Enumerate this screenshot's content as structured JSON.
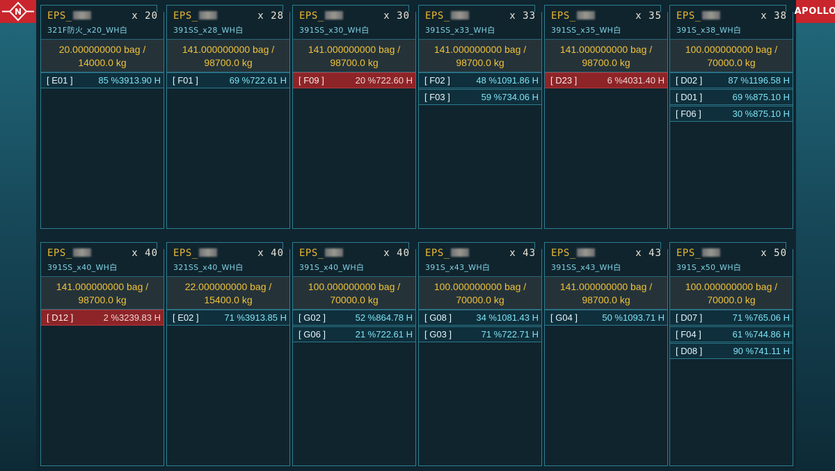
{
  "logos": {
    "left_symbol": "N",
    "right_text": "APOLLO"
  },
  "colors": {
    "accent_title": "#e7b830",
    "accent_cyan": "#7ee3f4",
    "alert_red": "#8d2428",
    "brand_red": "#c9252c"
  },
  "cards": [
    {
      "title": "EPS_",
      "count": "x 20",
      "subtitle": "321F防火_x20_WH白",
      "qty_line1": "20.000000000 bag /",
      "qty_line2": "14000.0 kg",
      "entries": [
        {
          "code": "[ E01 ]",
          "pct": "85 %",
          "hours": "3913.90 H",
          "alert": false
        }
      ]
    },
    {
      "title": "EPS_",
      "count": "x 28",
      "subtitle": "391SS_x28_WH白",
      "qty_line1": "141.000000000 bag /",
      "qty_line2": "98700.0 kg",
      "entries": [
        {
          "code": "[ F01 ]",
          "pct": "69 %",
          "hours": "722.61 H",
          "alert": false
        }
      ]
    },
    {
      "title": "EPS_",
      "count": "x 30",
      "subtitle": "391SS_x30_WH白",
      "qty_line1": "141.000000000 bag /",
      "qty_line2": "98700.0 kg",
      "entries": [
        {
          "code": "[ F09 ]",
          "pct": "20 %",
          "hours": "722.60 H",
          "alert": true
        }
      ]
    },
    {
      "title": "EPS_",
      "count": "x 33",
      "subtitle": "391SS_x33_WH白",
      "qty_line1": "141.000000000 bag /",
      "qty_line2": "98700.0 kg",
      "entries": [
        {
          "code": "[ F02 ]",
          "pct": "48 %",
          "hours": "1091.86 H",
          "alert": false
        },
        {
          "code": "[ F03 ]",
          "pct": "59 %",
          "hours": "734.06 H",
          "alert": false
        }
      ]
    },
    {
      "title": "EPS_",
      "count": "x 35",
      "subtitle": "391SS_x35_WH白",
      "qty_line1": "141.000000000 bag /",
      "qty_line2": "98700.0 kg",
      "entries": [
        {
          "code": "[ D23 ]",
          "pct": "6 %",
          "hours": "4031.40 H",
          "alert": true
        }
      ]
    },
    {
      "title": "EPS_",
      "count": "x 38",
      "subtitle": "391S_x38_WH白",
      "qty_line1": "100.000000000 bag /",
      "qty_line2": "70000.0 kg",
      "entries": [
        {
          "code": "[ D02 ]",
          "pct": "87 %",
          "hours": "1196.58 H",
          "alert": false
        },
        {
          "code": "[ D01 ]",
          "pct": "69 %",
          "hours": "875.10 H",
          "alert": false
        },
        {
          "code": "[ F06 ]",
          "pct": "30 %",
          "hours": "875.10 H",
          "alert": false
        }
      ]
    },
    {
      "title": "EPS_",
      "count": "x 40",
      "subtitle": "391SS_x40_WH白",
      "qty_line1": "141.000000000 bag /",
      "qty_line2": "98700.0 kg",
      "entries": [
        {
          "code": "[ D12 ]",
          "pct": "2 %",
          "hours": "3239.83 H",
          "alert": true
        }
      ]
    },
    {
      "title": "EPS_",
      "count": "x 40",
      "subtitle": "321SS_x40_WH白",
      "qty_line1": "22.000000000 bag /",
      "qty_line2": "15400.0 kg",
      "entries": [
        {
          "code": "[ E02 ]",
          "pct": "71 %",
          "hours": "3913.85 H",
          "alert": false
        }
      ]
    },
    {
      "title": "EPS_",
      "count": "x 40",
      "subtitle": "391S_x40_WH白",
      "qty_line1": "100.000000000 bag /",
      "qty_line2": "70000.0 kg",
      "entries": [
        {
          "code": "[ G02 ]",
          "pct": "52 %",
          "hours": "864.78 H",
          "alert": false
        },
        {
          "code": "[ G06 ]",
          "pct": "21 %",
          "hours": "722.61 H",
          "alert": false
        }
      ]
    },
    {
      "title": "EPS_",
      "count": "x 43",
      "subtitle": "391S_x43_WH白",
      "qty_line1": "100.000000000 bag /",
      "qty_line2": "70000.0 kg",
      "entries": [
        {
          "code": "[ G08 ]",
          "pct": "34 %",
          "hours": "1081.43 H",
          "alert": false
        },
        {
          "code": "[ G03 ]",
          "pct": "71 %",
          "hours": "722.71 H",
          "alert": false
        }
      ]
    },
    {
      "title": "EPS_",
      "count": "x 43",
      "subtitle": "391SS_x43_WH白",
      "qty_line1": "141.000000000 bag /",
      "qty_line2": "98700.0 kg",
      "entries": [
        {
          "code": "[ G04 ]",
          "pct": "50 %",
          "hours": "1093.71 H",
          "alert": false
        }
      ]
    },
    {
      "title": "EPS_",
      "count": "x 50",
      "subtitle": "391S_x50_WH白",
      "qty_line1": "100.000000000 bag /",
      "qty_line2": "70000.0 kg",
      "entries": [
        {
          "code": "[ D07 ]",
          "pct": "71 %",
          "hours": "765.06 H",
          "alert": false
        },
        {
          "code": "[ F04 ]",
          "pct": "61 %",
          "hours": "744.86 H",
          "alert": false
        },
        {
          "code": "[ D08 ]",
          "pct": "90 %",
          "hours": "741.11 H",
          "alert": false
        }
      ]
    }
  ]
}
